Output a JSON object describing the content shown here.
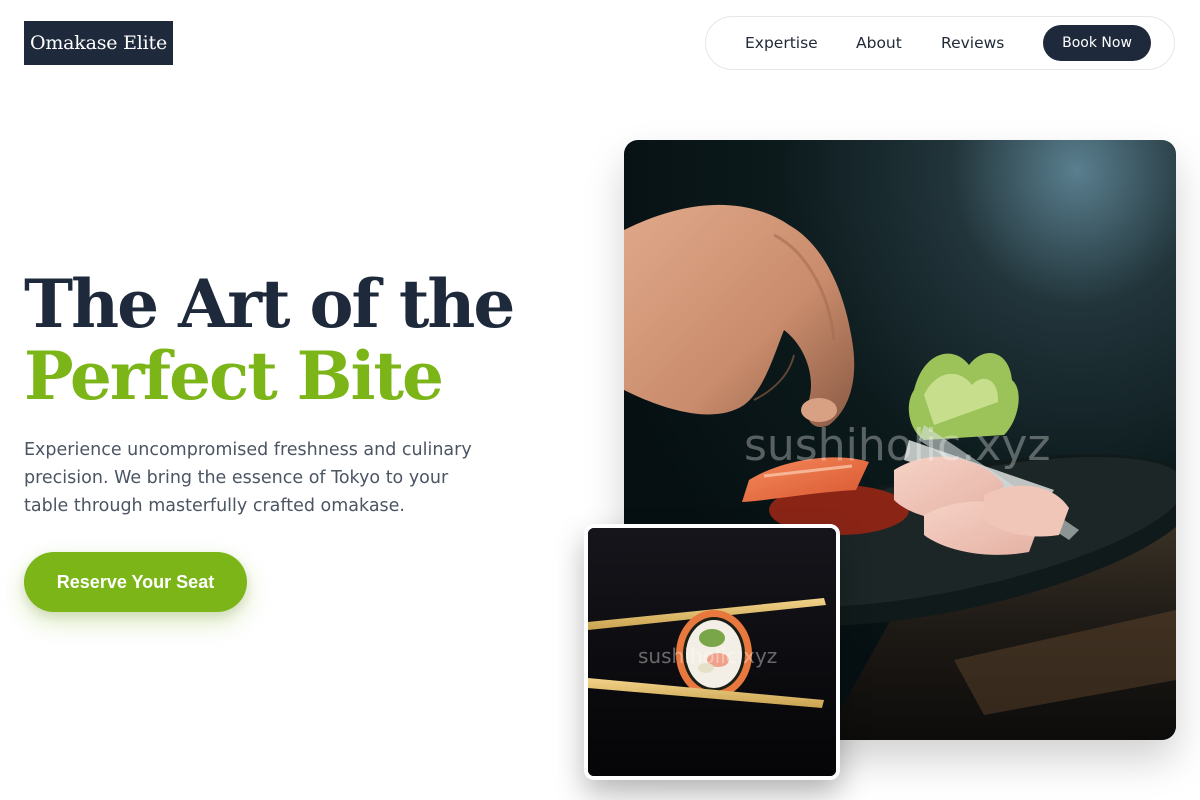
{
  "brand": {
    "logo_text": "Omakase Elite"
  },
  "nav": {
    "links": [
      "Expertise",
      "About",
      "Reviews"
    ],
    "cta_label": "Book Now"
  },
  "hero": {
    "title_line1": "The Art of the",
    "title_line2": "Perfect Bite",
    "description": "Experience uncompromised freshness and culinary precision. We bring the essence of Tokyo to your table through masterfully crafted omakase.",
    "cta_label": "Reserve Your Seat"
  },
  "images": {
    "main_alt": "Chef placing garnish on sashimi plate",
    "inset_alt": "Salmon maki roll held by chopsticks",
    "watermark": "sushiholic.xyz"
  },
  "colors": {
    "navy": "#1e293b",
    "accent_green": "#7cb518",
    "body_text": "#4b5563",
    "background": "#ffffff"
  }
}
